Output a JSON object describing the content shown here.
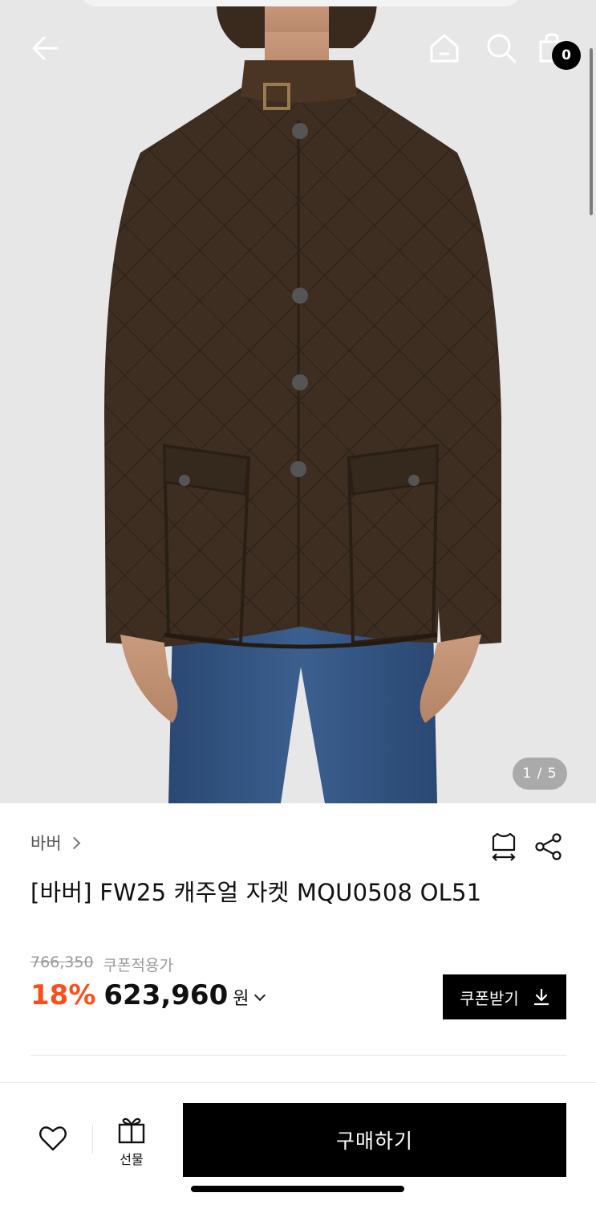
{
  "header": {
    "back_icon": "arrow-left-icon",
    "home_icon": "home-icon",
    "search_icon": "search-icon",
    "cart_icon": "shopping-bag-icon",
    "cart_count": "0"
  },
  "gallery": {
    "counter": "1 / 5",
    "current": 1,
    "total": 5
  },
  "product": {
    "brand": "바버",
    "title": "[바버] FW25 캐주얼 자켓 MQU0508 OL51",
    "original_price": "766,350",
    "coupon_label": "쿠폰적용가",
    "discount": "18%",
    "price": "623,960",
    "currency": "원"
  },
  "actions": {
    "size_icon": "size-guide-icon",
    "share_icon": "share-icon",
    "coupon_button": "쿠폰받기",
    "gift_label": "선물",
    "buy_button": "구매하기"
  },
  "colors": {
    "discount": "#ff4d1a",
    "primary": "#000000",
    "jacket": "#3b2c1f"
  }
}
